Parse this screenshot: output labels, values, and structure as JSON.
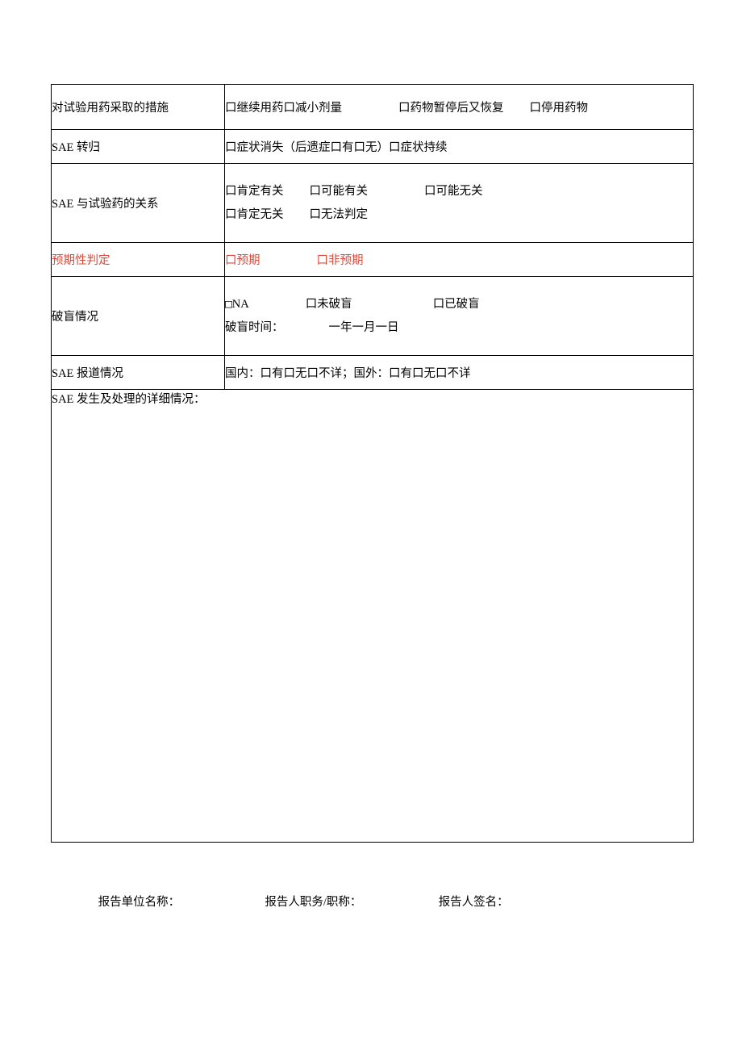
{
  "rows": {
    "measures": {
      "label": "对试验用药采取的措施",
      "opts": [
        "口继续用药",
        "口减小剂量",
        "口药物暂停后又恢复",
        "口停用药物"
      ]
    },
    "outcome": {
      "label": "SAE 转归",
      "text": "口症状消失（后遗症口有口无）口症状持续"
    },
    "relation": {
      "label": "SAE 与试验药的关系",
      "line1": [
        "口肯定有关",
        "口可能有关",
        "口可能无关"
      ],
      "line2": [
        "口肯定无关",
        "口无法判定"
      ]
    },
    "expect": {
      "label": "预期性判定",
      "opts": [
        "口预期",
        "口非预期"
      ]
    },
    "unblind": {
      "label": "破盲情况",
      "line1_a": "□",
      "line1_b": "NA",
      "line1_opts": [
        "口未破盲",
        "口已破盲"
      ],
      "line2_a": "破盲时间：",
      "line2_b": "一年一月一日"
    },
    "report": {
      "label": "SAE 报道情况",
      "text": "国内：口有口无口不详；国外：口有口无口不详"
    },
    "detail": {
      "label": "SAE 发生及处理的详细情况："
    }
  },
  "sig": {
    "unit": "报告单位名称：",
    "title": "报告人职务/职称：",
    "sign": "报告人签名："
  }
}
